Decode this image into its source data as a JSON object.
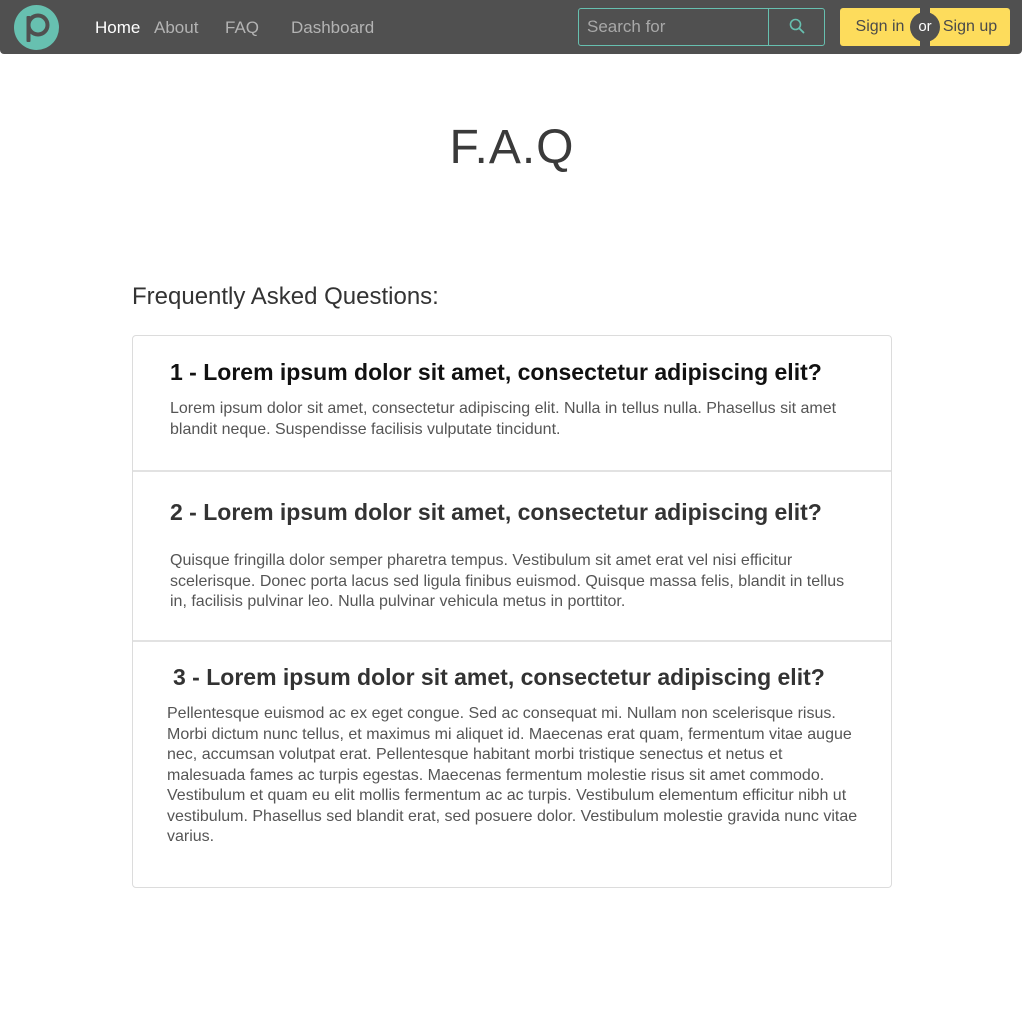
{
  "colors": {
    "navbar_bg": "#505050",
    "accent_teal": "#67c0b0",
    "button_yellow": "#fddc5c"
  },
  "nav": {
    "logo_icon": "p-logo-icon",
    "links": [
      {
        "label": "Home",
        "active": true
      },
      {
        "label": "About",
        "active": false
      },
      {
        "label": "FAQ",
        "active": false
      },
      {
        "label": "Dashboard",
        "active": false
      }
    ],
    "search": {
      "placeholder": "Search for",
      "value": "",
      "button_icon": "search-icon"
    },
    "auth": {
      "sign_in": "Sign in",
      "or": "or",
      "sign_up": "Sign up"
    }
  },
  "page": {
    "title": "F.A.Q",
    "section_heading": "Frequently Asked Questions:"
  },
  "faq": [
    {
      "question": "1 - Lorem ipsum dolor sit amet, consectetur adipiscing elit?",
      "answer": "Lorem ipsum dolor sit amet, consectetur adipiscing elit. Nulla in tellus nulla. Phasellus sit amet blandit neque. Suspendisse facilisis vulputate tincidunt."
    },
    {
      "question": "2 - Lorem ipsum dolor sit amet, consectetur adipiscing elit?",
      "answer": "Quisque fringilla dolor semper pharetra tempus. Vestibulum sit amet erat vel nisi efficitur scelerisque. Donec porta lacus sed ligula finibus euismod. Quisque massa felis, blandit in tellus in, facilisis pulvinar leo. Nulla pulvinar vehicula metus in porttitor."
    },
    {
      "question": "3 - Lorem ipsum dolor sit amet, consectetur adipiscing elit?",
      "answer": "Pellentesque euismod ac ex eget congue. Sed ac consequat mi. Nullam non scelerisque risus. Morbi dictum nunc tellus, et maximus mi aliquet id. Maecenas erat quam, fermentum vitae augue nec, accumsan volutpat erat. Pellentesque habitant morbi tristique senectus et netus et malesuada fames ac turpis egestas. Maecenas fermentum molestie risus sit amet commodo. Vestibulum et quam eu elit mollis fermentum ac ac turpis. Vestibulum elementum efficitur nibh ut vestibulum. Phasellus sed blandit erat, sed posuere dolor. Vestibulum molestie gravida nunc vitae varius."
    }
  ]
}
